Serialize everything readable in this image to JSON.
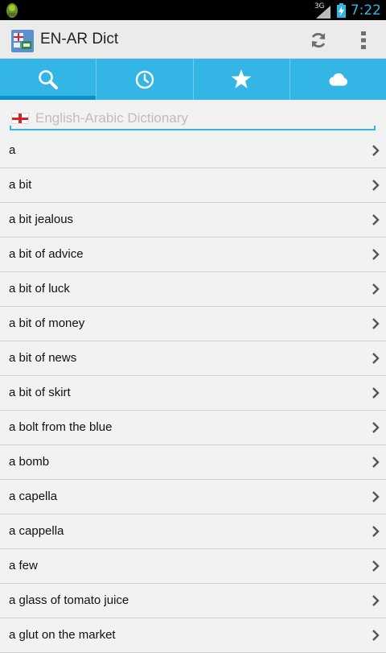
{
  "status_bar": {
    "network": "3G",
    "time": "7:22"
  },
  "app": {
    "title": "EN-AR Dict"
  },
  "toolbar": {
    "refresh_icon": "refresh-icon",
    "overflow_icon": "overflow-menu-icon"
  },
  "tabs": [
    {
      "icon": "search-icon",
      "selected": true
    },
    {
      "icon": "history-clock-icon",
      "selected": false
    },
    {
      "icon": "favorites-star-icon",
      "selected": false
    },
    {
      "icon": "cloud-icon",
      "selected": false
    }
  ],
  "search": {
    "placeholder": "English-Arabic Dictionary",
    "value": ""
  },
  "words": [
    "a",
    "a bit",
    "a bit jealous",
    "a bit of advice",
    "a bit of luck",
    "a bit of money",
    "a bit of news",
    "a bit of skirt",
    "a bolt from the blue",
    "a bomb",
    "a capella",
    "a cappella",
    "a few",
    "a glass of tomato juice",
    "a glut on the market"
  ],
  "colors": {
    "accent": "#33b5e5",
    "tab_indicator": "#0a93c6",
    "time": "#33b5e5"
  }
}
